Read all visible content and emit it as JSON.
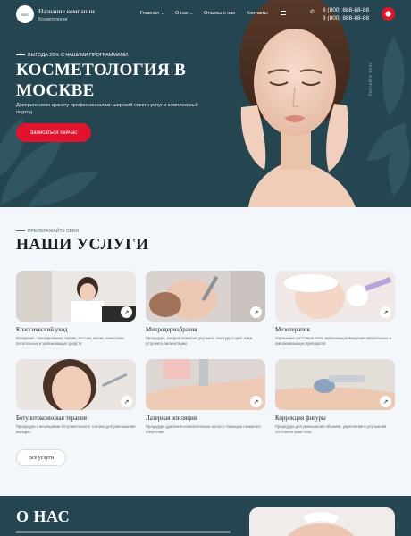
{
  "header": {
    "logo_text": "лого",
    "company_name": "Название компании",
    "company_subtitle": "Косметология",
    "nav": [
      {
        "label": "Главная",
        "has_dropdown": true
      },
      {
        "label": "О нас",
        "has_dropdown": true
      },
      {
        "label": "Отзывы о нас",
        "has_dropdown": false
      },
      {
        "label": "Контакты",
        "has_dropdown": false
      }
    ],
    "phones": [
      "8 (800) 888-88-88",
      "8 (800) 888-88-88"
    ],
    "icons": {
      "menu": "hamburger-icon",
      "phone": "phone-icon",
      "action": "location-pin-icon"
    },
    "accent_color": "#e2142d"
  },
  "hero": {
    "eyebrow": "ВЫГОДА 20% С НАШИМИ ПРОГРАММАМИ",
    "title": "КОСМЕТОЛОГИЯ В МОСКВЕ",
    "text": "Доверьте свою красоту профессионалам: широкий спектр услуг и комплексный подход",
    "cta": "Записаться сейчас",
    "side_label": "Листайте вниз",
    "background_color": "#254550"
  },
  "services": {
    "eyebrow": "ПРЕОБРАЖАЙТЕ СЕБЯ",
    "title": "НАШИ УСЛУГИ",
    "items": [
      {
        "title": "Классический уход",
        "desc": "Очищение, тонизирование, пилинг, массаж, маски, нанесение питательных и увлажняющих средств"
      },
      {
        "title": "Микродермабразия",
        "desc": "Процедура, которая помогает улучшить текстуру и цвет кожи, устранить пигментацию"
      },
      {
        "title": "Мезотерапия",
        "desc": "Улучшение состояния кожи, включающая введение питательных и омолаживающих препаратов"
      },
      {
        "title": "Ботулотоксиновая терапия",
        "desc": "Процедура с инъекциями ботулинического токсина для уменьшения морщин"
      },
      {
        "title": "Лазерная эпиляция",
        "desc": "Процедура удаления нежелательных волос с помощью лазерного облучения"
      },
      {
        "title": "Коррекция фигуры",
        "desc": "Процедура для уменьшения объемов, укрепления и улучшения состояния кожи тела"
      }
    ],
    "all_button": "Все услуги",
    "card_icon": "arrow-up-right-icon"
  },
  "about": {
    "title": "О НАС"
  }
}
